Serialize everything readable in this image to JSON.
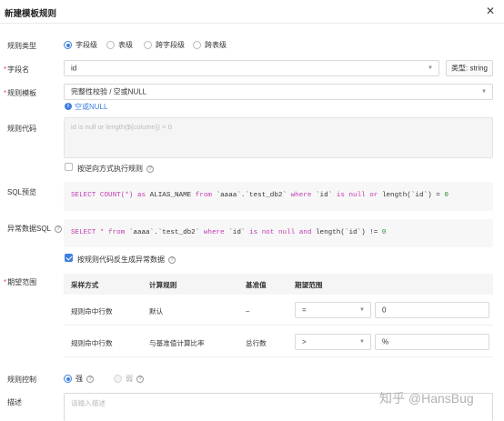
{
  "dialog": {
    "title": "新建模板规则",
    "close_icon": "close-icon"
  },
  "rule_type": {
    "label": "规则类型",
    "options": [
      "字段级",
      "表级",
      "跨字段级",
      "跨表级"
    ],
    "selected": "字段级"
  },
  "field_name": {
    "label": "字段名",
    "value": "id",
    "type_label": "类型: string"
  },
  "rule_template": {
    "label": "规则模板",
    "value": "完整性校验 / 空或NULL",
    "hint_link": "空或NULL"
  },
  "rule_code": {
    "label": "规则代码",
    "placeholder": "id is null or length(${column}) = 0"
  },
  "reverse_exec": {
    "label": "按逆向方式执行规则",
    "checked": false
  },
  "sql_preview": {
    "label": "SQL预览",
    "tokens": [
      "SELECT",
      "COUNT(*)",
      "as",
      "ALIAS_NAME",
      "from",
      "`aaaa`.`test_db2`",
      "where",
      "`id`",
      "is",
      "null",
      "or",
      "length(`id`)",
      "=",
      "0"
    ]
  },
  "abnormal_sql": {
    "label": "异常数据SQL",
    "tokens": [
      "SELECT",
      "*",
      "from",
      "`aaaa`.`test_db2`",
      "where",
      "`id`",
      "is",
      "not",
      "null",
      "and",
      "length(`id`)",
      "!=",
      "0"
    ]
  },
  "gen_abnormal": {
    "label": "按规则代码反生成异常数据",
    "checked": true
  },
  "expect_range": {
    "label": "期望范围",
    "headers": [
      "采样方式",
      "计算规则",
      "基准值",
      "期望范围"
    ],
    "rows": [
      {
        "sample": "规则命中行数",
        "rule": "默认",
        "base": "–",
        "op": "=",
        "value": "0"
      },
      {
        "sample": "规则命中行数",
        "rule": "与基准值计算比率",
        "base": "总行数",
        "op": ">",
        "value": "%"
      }
    ]
  },
  "rule_control": {
    "label": "规则控制",
    "options": [
      "强",
      "弱"
    ],
    "selected": "强"
  },
  "description": {
    "label": "描述",
    "placeholder": "请输入描述"
  },
  "watermark": "知乎 @HansBug"
}
